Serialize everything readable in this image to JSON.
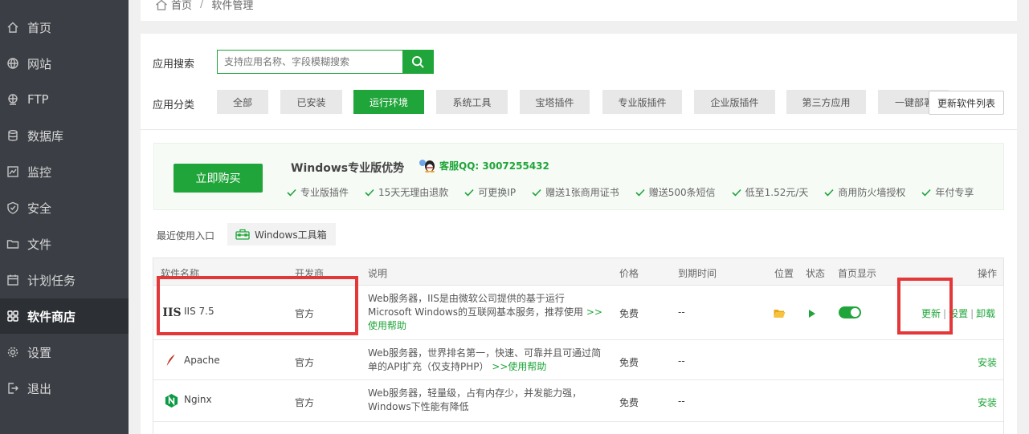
{
  "sidebar": {
    "items": [
      {
        "label": "首页",
        "icon": "home-icon"
      },
      {
        "label": "网站",
        "icon": "globe-icon"
      },
      {
        "label": "FTP",
        "icon": "ftp-icon"
      },
      {
        "label": "数据库",
        "icon": "database-icon"
      },
      {
        "label": "监控",
        "icon": "monitor-icon"
      },
      {
        "label": "安全",
        "icon": "shield-icon"
      },
      {
        "label": "文件",
        "icon": "folder-icon"
      },
      {
        "label": "计划任务",
        "icon": "calendar-icon"
      },
      {
        "label": "软件商店",
        "icon": "grid-icon",
        "active": true
      },
      {
        "label": "设置",
        "icon": "gear-icon"
      },
      {
        "label": "退出",
        "icon": "logout-icon"
      }
    ]
  },
  "breadcrumb": {
    "home": "首页",
    "separator": "/",
    "current": "软件管理"
  },
  "search": {
    "label": "应用搜索",
    "placeholder": "支持应用名称、字段模糊搜索"
  },
  "categories": {
    "label": "应用分类",
    "items": [
      "全部",
      "已安装",
      "运行环境",
      "系统工具",
      "宝塔插件",
      "专业版插件",
      "企业版插件",
      "第三方应用",
      "一键部署"
    ],
    "active": "运行环境",
    "refresh_label": "更新软件列表"
  },
  "promo": {
    "buy_label": "立即购买",
    "title": "Windows专业版优势",
    "qq_label": "客服QQ: 3007255432",
    "features": [
      "专业版插件",
      "15天无理由退款",
      "可更换IP",
      "赠送1张商用证书",
      "赠送500条短信",
      "低至1.52元/天",
      "商用防火墙授权",
      "年付专享"
    ]
  },
  "recent": {
    "label": "最近使用入口",
    "tool": "Windows工具箱"
  },
  "table": {
    "headers": {
      "name": "软件名称",
      "developer": "开发商",
      "desc": "说明",
      "price": "价格",
      "expire": "到期时间",
      "location": "位置",
      "status": "状态",
      "homepage": "首页显示",
      "actions": "操作"
    },
    "rows": [
      {
        "name": "IIS 7.5",
        "developer": "官方",
        "desc": "Web服务器，IIS是由微软公司提供的基于运行Microsoft Windows的互联网基本服务，推荐使用",
        "help": ">>使用帮助",
        "price": "免费",
        "expire": "--",
        "actions": [
          "更新",
          "设置",
          "卸载"
        ],
        "separator": "|"
      },
      {
        "name": "Apache",
        "developer": "官方",
        "desc": "Web服务器，世界排名第一，快速、可靠并且可通过简单的API扩充（仅支持PHP）",
        "help": ">>使用帮助",
        "price": "免费",
        "expire": "--",
        "actions": [
          "安装"
        ]
      },
      {
        "name": "Nginx",
        "developer": "官方",
        "desc": "Web服务器，轻量级，占有内存少，并发能力强，Windows下性能有降低",
        "help": "",
        "price": "免费",
        "expire": "--",
        "actions": [
          "安装"
        ]
      }
    ]
  },
  "colors": {
    "accent": "#20a53a",
    "highlight": "#e4373a",
    "sidebar_bg": "#3b3f45"
  }
}
